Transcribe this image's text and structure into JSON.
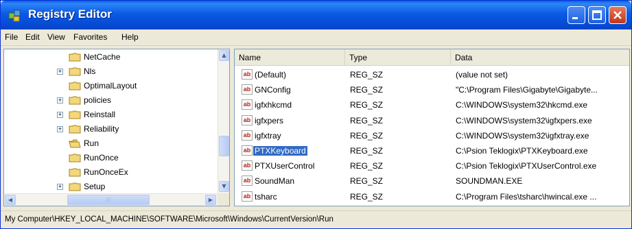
{
  "window": {
    "title": "Registry Editor"
  },
  "menu": {
    "file": "File",
    "edit": "Edit",
    "view": "View",
    "favorites": "Favorites",
    "help": "Help"
  },
  "tree": {
    "items": [
      {
        "label": "NetCache",
        "expander": ""
      },
      {
        "label": "Nls",
        "expander": "+"
      },
      {
        "label": "OptimalLayout",
        "expander": ""
      },
      {
        "label": "policies",
        "expander": "+"
      },
      {
        "label": "Reinstall",
        "expander": "+"
      },
      {
        "label": "Reliability",
        "expander": "+"
      },
      {
        "label": "Run",
        "expander": ""
      },
      {
        "label": "RunOnce",
        "expander": ""
      },
      {
        "label": "RunOnceEx",
        "expander": ""
      },
      {
        "label": "Setup",
        "expander": "+"
      }
    ]
  },
  "list": {
    "columns": {
      "name": "Name",
      "type": "Type",
      "data": "Data"
    },
    "rows": [
      {
        "name": "(Default)",
        "type": "REG_SZ",
        "data": "(value not set)"
      },
      {
        "name": "GNConfig",
        "type": "REG_SZ",
        "data": "\"C:\\Program Files\\Gigabyte\\Gigabyte..."
      },
      {
        "name": "igfxhkcmd",
        "type": "REG_SZ",
        "data": "C:\\WINDOWS\\system32\\hkcmd.exe"
      },
      {
        "name": "igfxpers",
        "type": "REG_SZ",
        "data": "C:\\WINDOWS\\system32\\igfxpers.exe"
      },
      {
        "name": "igfxtray",
        "type": "REG_SZ",
        "data": "C:\\WINDOWS\\system32\\igfxtray.exe"
      },
      {
        "name": "PTXKeyboard",
        "type": "REG_SZ",
        "data": "C:\\Psion Teklogix\\PTXKeyboard.exe"
      },
      {
        "name": "PTXUserControl",
        "type": "REG_SZ",
        "data": "C:\\Psion Teklogix\\PTXUserControl.exe"
      },
      {
        "name": "SoundMan",
        "type": "REG_SZ",
        "data": "SOUNDMAN.EXE"
      },
      {
        "name": "tsharc",
        "type": "REG_SZ",
        "data": "C:\\Program Files\\tsharc\\hwincal.exe ..."
      }
    ],
    "icon_text": "ab"
  },
  "status": {
    "path": "My Computer\\HKEY_LOCAL_MACHINE\\SOFTWARE\\Microsoft\\Windows\\CurrentVersion\\Run"
  },
  "colors": {
    "titlebar": "#0a5fe0",
    "selection": "#316ac5",
    "chrome": "#ece9d8"
  }
}
